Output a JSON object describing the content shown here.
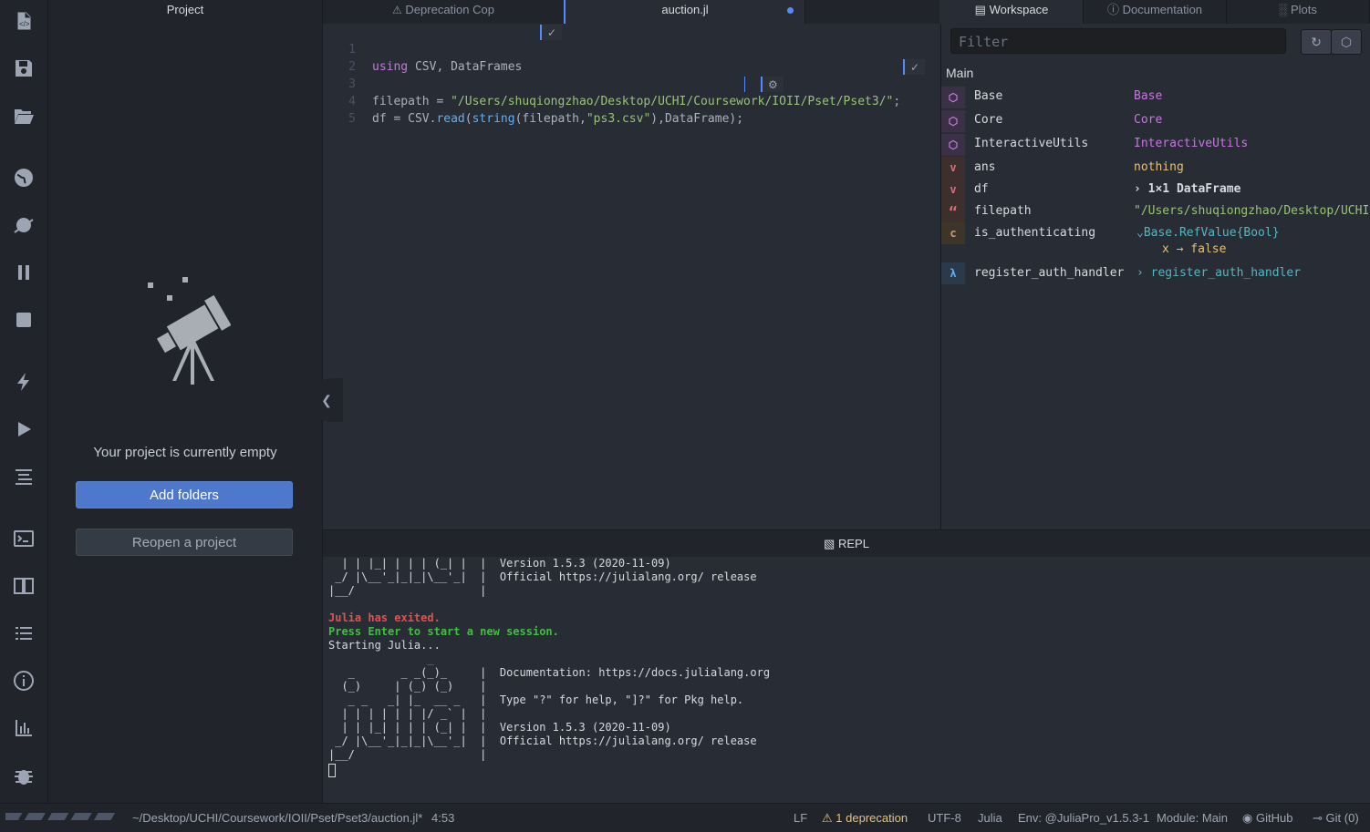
{
  "project": {
    "title": "Project",
    "empty_message": "Your project is currently empty",
    "add_folders": "Add folders",
    "reopen": "Reopen a project"
  },
  "tabs": {
    "deprecation": "Deprecation Cop",
    "auction": "auction.jl"
  },
  "editor": {
    "lines": [
      {
        "n": "1"
      },
      {
        "n": "2"
      },
      {
        "n": "3"
      },
      {
        "n": "4"
      },
      {
        "n": "5"
      }
    ],
    "line1": {
      "kw": "using",
      "rest": " CSV, DataFrames"
    },
    "line3": {
      "pre": "filepath = ",
      "str": "\"/Users/shuqiongzhao/Desktop/UCHI/Coursework/IOII/Pset/Pset3/\"",
      "post": ";"
    },
    "line4": {
      "a": "df = CSV.",
      "fn1": "read",
      "b": "(",
      "fn2": "string",
      "c": "(filepath,",
      "str": "\"ps3.csv\"",
      "d": "),DataFrame);"
    }
  },
  "right_tabs": {
    "workspace": "Workspace",
    "documentation": "Documentation",
    "plots": "Plots"
  },
  "workspace": {
    "filter_placeholder": "Filter",
    "module": "Main",
    "rows": [
      {
        "icon": "module",
        "name": "Base",
        "value": "Base"
      },
      {
        "icon": "module",
        "name": "Core",
        "value": "Core"
      },
      {
        "icon": "module",
        "name": "InteractiveUtils",
        "value": "InteractiveUtils"
      },
      {
        "icon": "v",
        "name": "ans",
        "value": "nothing"
      },
      {
        "icon": "v",
        "name": "df",
        "value": "1×1 DataFrame"
      },
      {
        "icon": "quote",
        "name": "filepath",
        "value": "\"/Users/shuqiongzhao/Desktop/UCHI/"
      },
      {
        "icon": "c",
        "name": "is_authenticating",
        "value": "Base.RefValue{Bool}",
        "sub": "x → false"
      },
      {
        "icon": "λ",
        "name": "register_auth_handler",
        "value": "register_auth_handler"
      }
    ]
  },
  "repl": {
    "header": "REPL",
    "lines": [
      "  | | |_| | | | (_| |  |  Version 1.5.3 (2020-11-09)",
      " _/ |\\__'_|_|_|\\__'_|  |  Official https://julialang.org/ release",
      "|__/                   |",
      "",
      "Julia has exited.",
      "Press Enter to start a new session.",
      "Starting Julia...",
      "               _",
      "   _       _ _(_)_     |  Documentation: https://docs.julialang.org",
      "  (_)     | (_) (_)    |",
      "   _ _   _| |_  __ _   |  Type \"?\" for help, \"]?\" for Pkg help.",
      "  | | | | | | |/ _` |  |",
      "  | | |_| | | | (_| |  |  Version 1.5.3 (2020-11-09)",
      " _/ |\\__'_|_|_|\\__'_|  |  Official https://julialang.org/ release",
      "|__/                   |"
    ]
  },
  "status": {
    "path": "~/Desktop/UCHI/Coursework/IOII/Pset/Pset3/auction.jl*",
    "cursor": "4:53",
    "eol": "LF",
    "deprecation": "1 deprecation",
    "encoding": "UTF-8",
    "grammar": "Julia",
    "env": "Env: @JuliaPro_v1.5.3-1",
    "module": "Module: Main",
    "github": "GitHub",
    "git": "Git (0)"
  },
  "colors": {
    "accent": "#528bff",
    "add_button": "#4d78cc",
    "exited": "#e05252",
    "restart": "#3fbf3f",
    "module_icon": "#c678dd",
    "string": "#98c379",
    "warning": "#e5c07b"
  }
}
